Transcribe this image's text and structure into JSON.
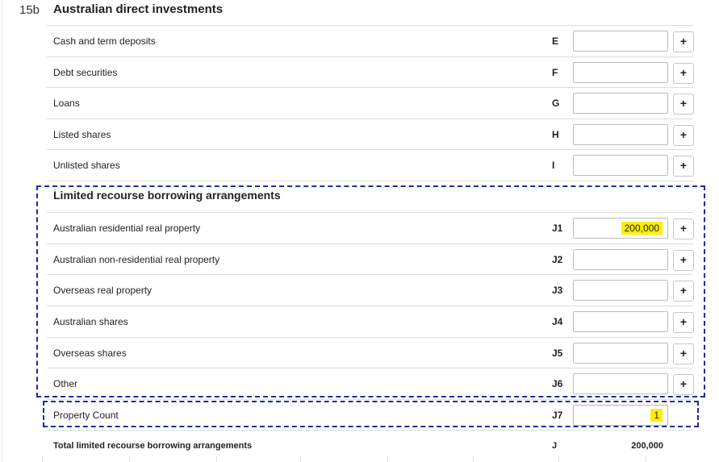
{
  "section": {
    "number": "15b",
    "title": "Australian direct investments"
  },
  "direct_rows": [
    {
      "label": "Cash and term deposits",
      "code": "E",
      "value": ""
    },
    {
      "label": "Debt securities",
      "code": "F",
      "value": ""
    },
    {
      "label": "Loans",
      "code": "G",
      "value": ""
    },
    {
      "label": "Listed shares",
      "code": "H",
      "value": ""
    },
    {
      "label": "Unlisted shares",
      "code": "I",
      "value": ""
    }
  ],
  "lrba": {
    "title": "Limited recourse borrowing arrangements",
    "rows": [
      {
        "label": "Australian residential real property",
        "code": "J1",
        "value": "200,000"
      },
      {
        "label": "Australian non-residential real property",
        "code": "J2",
        "value": ""
      },
      {
        "label": "Overseas real property",
        "code": "J3",
        "value": ""
      },
      {
        "label": "Australian shares",
        "code": "J4",
        "value": ""
      },
      {
        "label": "Overseas shares",
        "code": "J5",
        "value": ""
      },
      {
        "label": "Other",
        "code": "J6",
        "value": ""
      }
    ]
  },
  "property_count": {
    "label": "Property Count",
    "code": "J7",
    "value": "1"
  },
  "total": {
    "label": "Total limited recourse borrowing arrangements",
    "code": "J",
    "value": "200,000"
  },
  "plus_label": "+",
  "highlight_color": "#ffee00",
  "dash_color": "#1f2aa0"
}
